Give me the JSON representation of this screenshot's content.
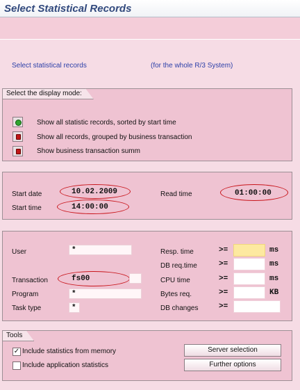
{
  "window": {
    "title": "Select Statistical Records"
  },
  "intro": {
    "left": "Select statistical records",
    "right": "(for the whole R/3 System)"
  },
  "display_mode": {
    "title": "Select the display mode:",
    "options": [
      {
        "label": "Show all statistic records, sorted by start time",
        "state": "green"
      },
      {
        "label": "Show all records, grouped by business transaction",
        "state": "red"
      },
      {
        "label": "Show business transaction summ",
        "state": "red"
      }
    ]
  },
  "time": {
    "start_date_label": "Start date",
    "start_date": "10.02.2009",
    "start_time_label": "Start time",
    "start_time": "14:00:00",
    "read_time_label": "Read time",
    "read_time": "01:00:00"
  },
  "filters": {
    "user_label": "User",
    "user": "*",
    "transaction_label": "Transaction",
    "transaction": "fs00",
    "program_label": "Program",
    "program": "*",
    "task_type_label": "Task type",
    "task_type": "*",
    "resp_label": "Resp. time",
    "resp_op": ">=",
    "resp_unit": "ms",
    "dbreq_label": "DB req.time",
    "dbreq_op": ">=",
    "dbreq_unit": "ms",
    "cpu_label": "CPU time",
    "cpu_op": ">=",
    "cpu_unit": "ms",
    "bytes_label": "Bytes req.",
    "bytes_op": ">=",
    "bytes_unit": "KB",
    "dbchg_label": "DB changes",
    "dbchg_op": ">="
  },
  "tools": {
    "title": "Tools",
    "memory_label": "Include statistics from memory",
    "memory_checked": true,
    "app_label": "Include application statistics",
    "app_checked": false,
    "server_btn": "Server selection",
    "further_btn": "Further options"
  },
  "colors": {
    "highlight": "#c8141a",
    "accent_text": "#2b3fa8",
    "panel": "#efc3d2"
  }
}
